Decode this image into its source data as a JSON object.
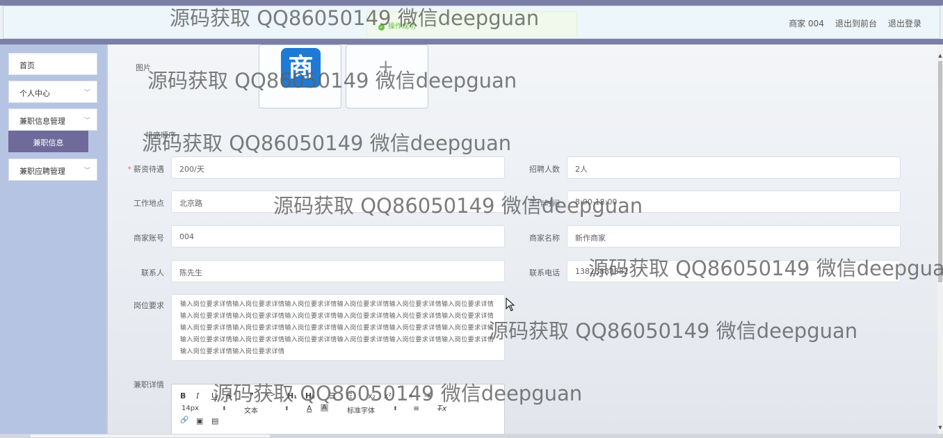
{
  "header": {
    "user": "商家 004",
    "to_front": "退出到前台",
    "logout": "退出登录"
  },
  "toast": {
    "message": "操作成功"
  },
  "sidebar": {
    "items": [
      {
        "label": "首页"
      },
      {
        "label": "个人中心"
      },
      {
        "label": "兼职信息管理"
      },
      {
        "label": "兼职应聘管理"
      }
    ],
    "active_sub": "兼职信息"
  },
  "form": {
    "image_label": "图片",
    "logo_char": "商",
    "sort_label": "排序顺序",
    "salary": {
      "label": "薪资待遇",
      "value": "200/天"
    },
    "headcount": {
      "label": "招聘人数",
      "value": "2人"
    },
    "location": {
      "label": "工作地点",
      "value": "北京路"
    },
    "work_time": {
      "label": "工作时间",
      "value": "8:00-18:00"
    },
    "merchant_account": {
      "label": "商家账号",
      "value": "004"
    },
    "merchant_name": {
      "label": "商家名称",
      "value": "新作商家"
    },
    "contact": {
      "label": "联系人",
      "value": "陈先生"
    },
    "phone": {
      "label": "联系电话",
      "value": "13823888882"
    },
    "requirements": {
      "label": "岗位要求",
      "value": "输入岗位要求详情输入岗位要求详情输入岗位要求详情输入岗位要求详情输入岗位要求详情输入岗位要求详情输入岗位要求详情输入岗位要求详情输入岗位要求详情输入岗位要求详情输入岗位要求详情输入岗位要求详情输入岗位要求详情输入岗位要求详情输入岗位要求详情输入岗位要求详情输入岗位要求详情输入岗位要求详情输入岗位要求详情输入岗位要求详情输入岗位要求详情输入岗位要求详情输入岗位要求详情输入岗位要求详情输入岗位要求详情输入岗位要求详情"
    },
    "details_label": "兼职详情"
  },
  "editor": {
    "bold": "B",
    "italic": "I",
    "underline": "U",
    "strike": "S",
    "quote": "❞",
    "code": "<>",
    "h1": "H₁",
    "h2": "H₂",
    "ol": "☰",
    "ul": "☷",
    "sub": "x₂",
    "sup": "x²",
    "indent_in": "⇤",
    "indent_out": "⇥",
    "font_size": "14px",
    "text_type": "文本",
    "font_family": "标准字体",
    "font_color": "A",
    "bg_color": "A",
    "align": "≡",
    "clear": "T̶x",
    "link": "🔗",
    "image": "▣",
    "video": "▤"
  },
  "watermark": "源码获取 QQ86050149 微信deepguan"
}
